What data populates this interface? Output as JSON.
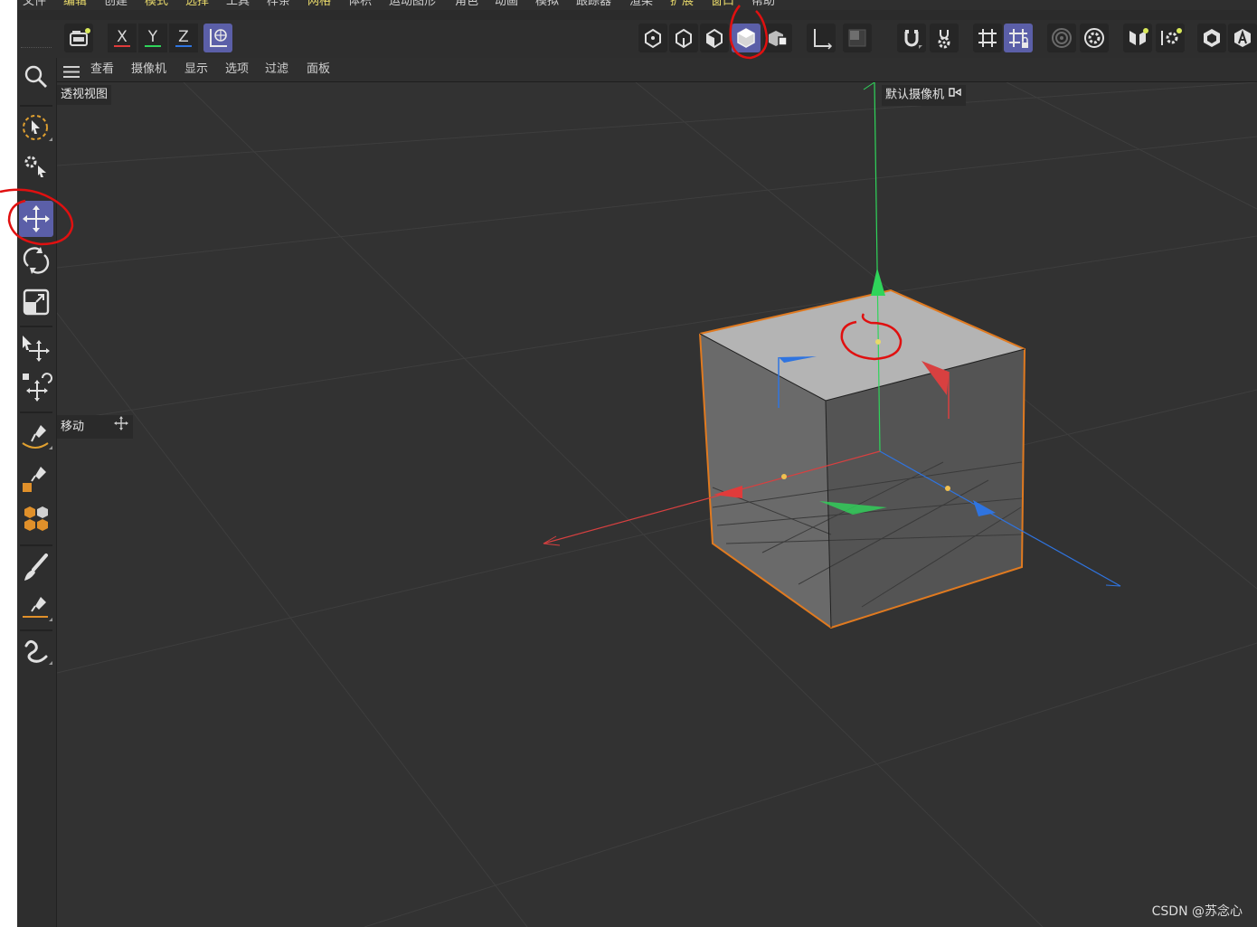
{
  "menubar": [
    "文件",
    "编辑",
    "创建",
    "模式",
    "选择",
    "工具",
    "样条",
    "网格",
    "体积",
    "运动图形",
    "角色",
    "动画",
    "模拟",
    "跟踪器",
    "渲染",
    "扩展",
    "窗口",
    "帮助"
  ],
  "toolbar": {
    "axes": [
      "X",
      "Y",
      "Z"
    ],
    "icons": [
      "camera-icon",
      "axis-x-lock",
      "axis-y-lock",
      "axis-z-lock",
      "world-coordinates-icon",
      "points-mode-icon",
      "edges-mode-icon",
      "polygons-mode-icon",
      "model-mode-icon",
      "texture-mode-icon",
      "axis-mode-icon",
      "solo-icon",
      "snap-icon",
      "snap-settings-icon",
      "grid-icon",
      "workplane-icon",
      "render-region-icon",
      "render-settings-icon",
      "symmetry-icon",
      "symmetry-settings-icon",
      "hexagon-icon",
      "avatar-icon"
    ]
  },
  "palette": [
    "search-icon",
    "live-select-icon",
    "select-settings-icon",
    "move-icon",
    "rotate-icon",
    "scale-icon",
    "transform-move-icon",
    "transform-all-icon",
    "pen-curve-icon",
    "pen-shape-icon",
    "cubes-icon",
    "brush-icon",
    "pen-line-icon",
    "spline-icon"
  ],
  "viewport_menu": [
    "查看",
    "摄像机",
    "显示",
    "选项",
    "过滤",
    "面板"
  ],
  "viewport": {
    "title": "透视视图",
    "camera": "默认摄像机",
    "tool_label": "移动"
  },
  "watermark": "CSDN @苏念心",
  "colors": {
    "accent": "#5b5fa8",
    "x_axis": "#e03b3b",
    "y_axis": "#2fd45a",
    "z_axis": "#2f74e0",
    "selection": "#e07a20",
    "annotation": "#e01010"
  }
}
